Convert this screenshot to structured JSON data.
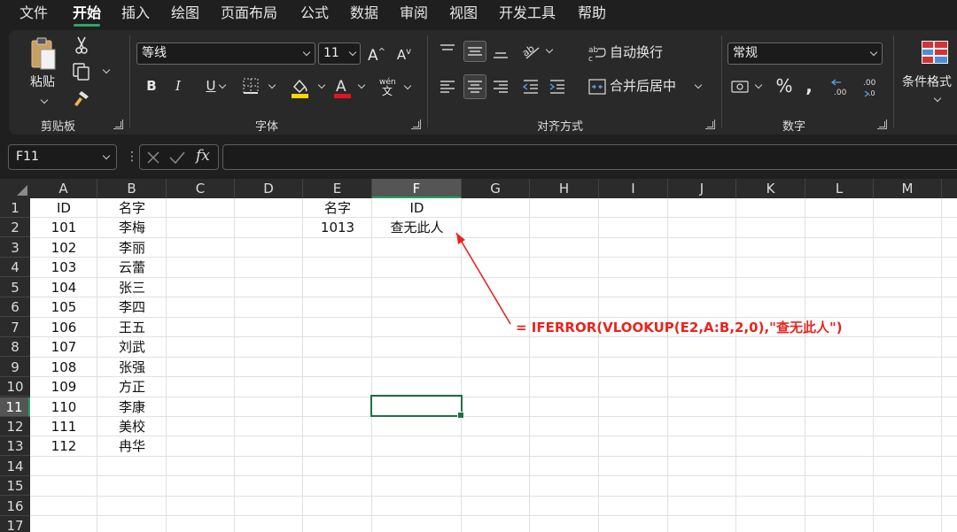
{
  "menu": {
    "tabs": [
      "文件",
      "开始",
      "插入",
      "绘图",
      "页面布局",
      "公式",
      "数据",
      "审阅",
      "视图",
      "开发工具",
      "帮助"
    ],
    "active": "开始"
  },
  "ribbon": {
    "clipboard": {
      "label": "剪贴板",
      "paste_label": "粘贴"
    },
    "font": {
      "label": "字体",
      "font_name": "等线",
      "font_size": "11",
      "phonetic_top": "wén",
      "phonetic_bottom": "文",
      "fill_color": "#ffd700",
      "font_color": "#e81123"
    },
    "alignment": {
      "label": "对齐方式",
      "wrap_text": "自动换行",
      "merge_center": "合并后居中"
    },
    "number": {
      "label": "数字",
      "format": "常规"
    },
    "styles": {
      "conditional_format": "条件格式"
    }
  },
  "formula_bar": {
    "name_box": "F11",
    "formula": "",
    "fx": "fx"
  },
  "sheet": {
    "columns": [
      "A",
      "B",
      "C",
      "D",
      "E",
      "F",
      "G",
      "H",
      "I",
      "J",
      "K",
      "L",
      "M"
    ],
    "selected_column": "F",
    "rows": [
      "1",
      "2",
      "3",
      "4",
      "5",
      "6",
      "7",
      "8",
      "9",
      "10",
      "11",
      "12",
      "13",
      "14",
      "15",
      "16",
      "17"
    ],
    "selected_row": "11",
    "colA": [
      "ID",
      "101",
      "102",
      "103",
      "104",
      "105",
      "106",
      "107",
      "108",
      "109",
      "110",
      "111",
      "112"
    ],
    "colB": [
      "名字",
      "李梅",
      "李丽",
      "云蕾",
      "张三",
      "李四",
      "王五",
      "刘武",
      "张强",
      "方正",
      "李康",
      "美校",
      "冉华"
    ],
    "E1": "名字",
    "F1": "ID",
    "E2": "1013",
    "F2": "查无此人",
    "selected_cell": "F11"
  },
  "annotation": {
    "text": "= IFERROR(VLOOKUP(E2,A:B,2,0),\"查无此人\")",
    "color": "#e8241f"
  }
}
